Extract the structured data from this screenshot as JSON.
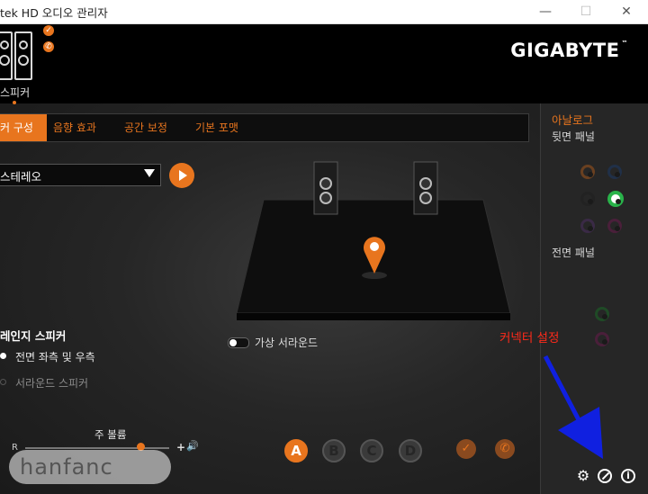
{
  "window": {
    "title": "tek HD 오디오 관리자",
    "controls": {
      "minimize": "—",
      "maximize": "☐",
      "close": "✕"
    }
  },
  "header": {
    "brand": "GIGABYTE",
    "brand_mark": "™",
    "device_tab_label": "스피커"
  },
  "tabs": [
    {
      "label": "구성",
      "prefix": "커",
      "active": true
    },
    {
      "label": "음향 효과",
      "active": false
    },
    {
      "label": "공간 보정",
      "active": false
    },
    {
      "label": "기본 포맷",
      "active": false
    }
  ],
  "config": {
    "selected": "스테레오",
    "play_icon": "play-icon"
  },
  "fullrange": {
    "heading": "레인지 스피커",
    "options": [
      {
        "label": "전면 좌측 및 우측",
        "checked": true
      },
      {
        "label": "서라운드 스피커",
        "checked": false
      }
    ]
  },
  "virtual_surround": {
    "label": "가상 서라운드",
    "enabled": false
  },
  "volume": {
    "label": "주 볼륨",
    "left_label": "R",
    "plus_icon": "+",
    "speaker_icon": "🔊",
    "level": 0.8
  },
  "bottom_buttons": [
    "A",
    "B",
    "C",
    "D"
  ],
  "right_panel": {
    "title": "아날로그",
    "back_panel": "뒷면 패널",
    "front_panel": "전면 패널",
    "annotation": "커넥터 설정"
  },
  "watermark": "hanfanc",
  "colors": {
    "accent": "#e8751e",
    "annotation": "#ff2a1a",
    "arrow": "#1020e0",
    "jack_green": "#29b34a"
  }
}
